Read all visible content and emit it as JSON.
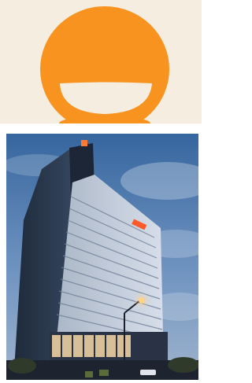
{
  "logo": {
    "icon": "smiley-face-icon",
    "fg_color": "#f7931e",
    "bg_color": "#f4ede0"
  },
  "photo": {
    "subject": "building-photo",
    "sky_top": "#3f6faa",
    "sky_bottom": "#9db7d6",
    "building_color": "#c9d4e2",
    "accent_color": "#ff6a2a"
  }
}
